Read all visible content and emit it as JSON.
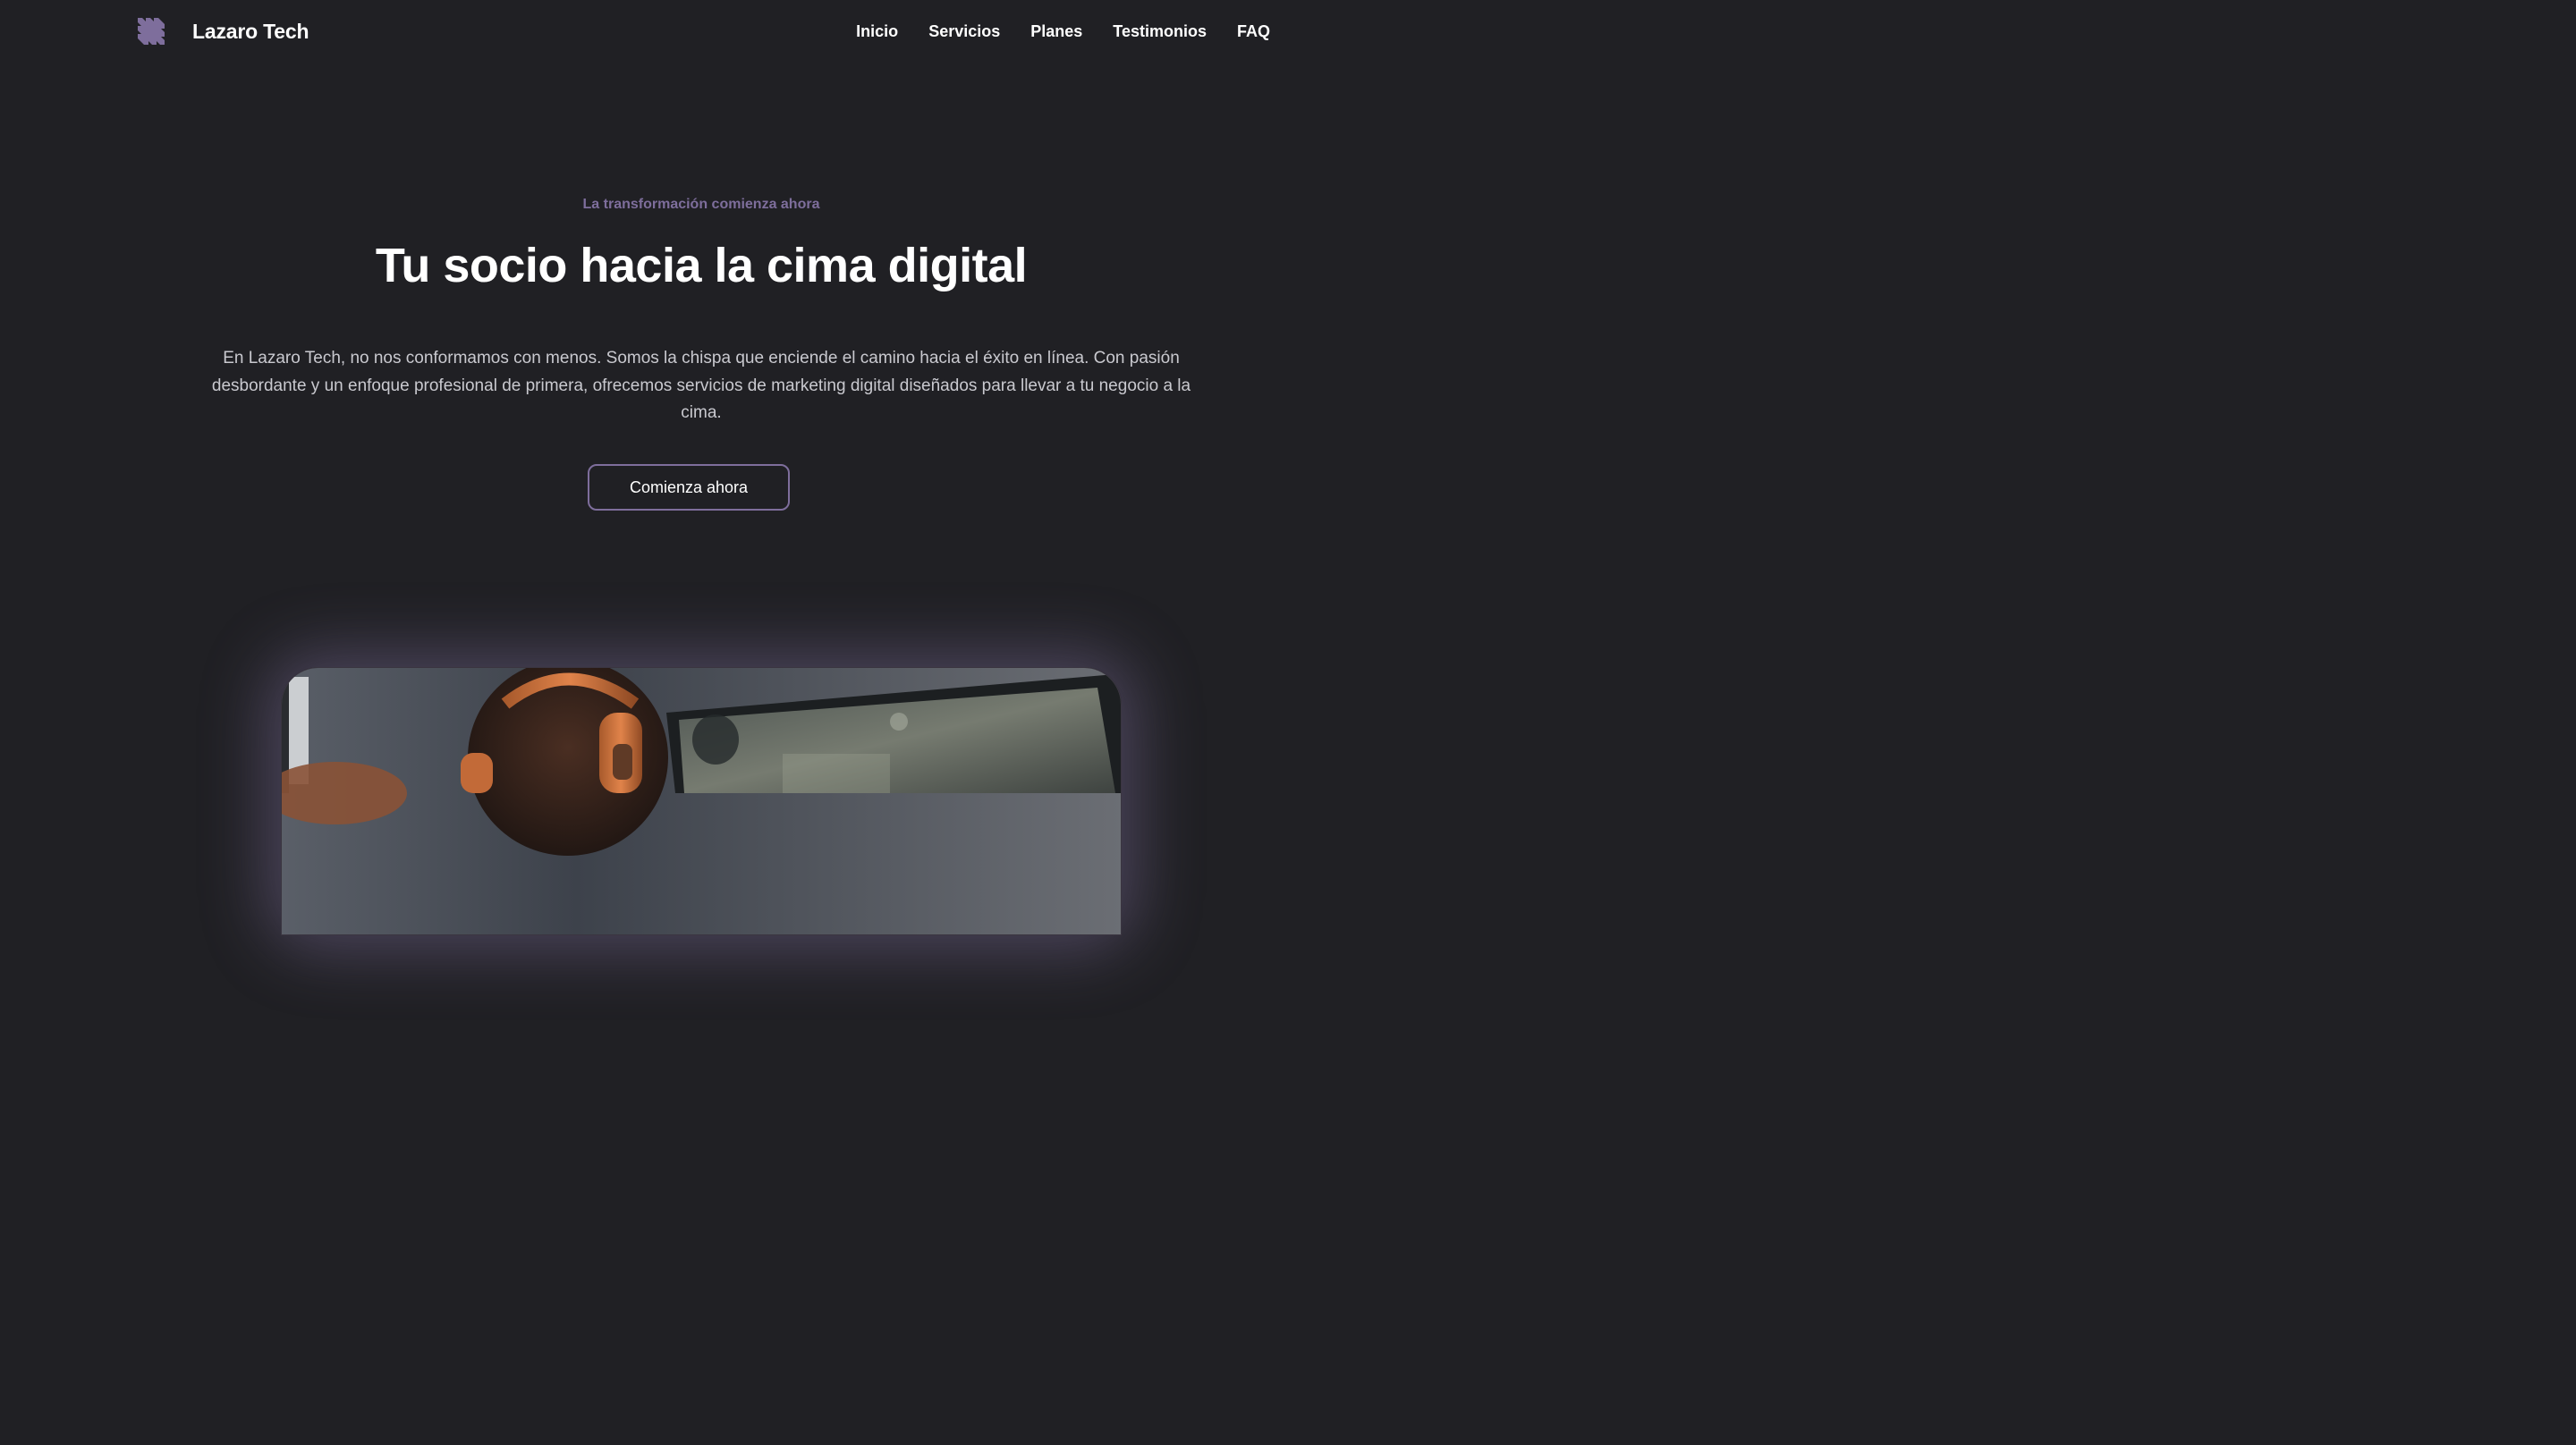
{
  "navbar": {
    "brand_name": "Lazaro Tech",
    "logo_icon": "lazaro-tech-logo-icon",
    "links": [
      "Inicio",
      "Servicios",
      "Planes",
      "Testimonios",
      "FAQ"
    ]
  },
  "hero": {
    "eyebrow": "La transformación comienza ahora",
    "headline": "Tu socio hacia la cima digital",
    "description": "En Lazaro Tech, no nos conformamos con menos. Somos la chispa que enciende el camino hacia el éxito en línea. Con pasión desbordante y un enfoque profesional de primera, ofrecemos servicios de marketing digital diseñados para llevar a tu negocio a la cima.",
    "cta_label": "Comienza ahora"
  },
  "colors": {
    "background": "#202024",
    "accent": "#7e6e9c",
    "text": "#ffffff",
    "muted_text": "#c9c9cf"
  }
}
